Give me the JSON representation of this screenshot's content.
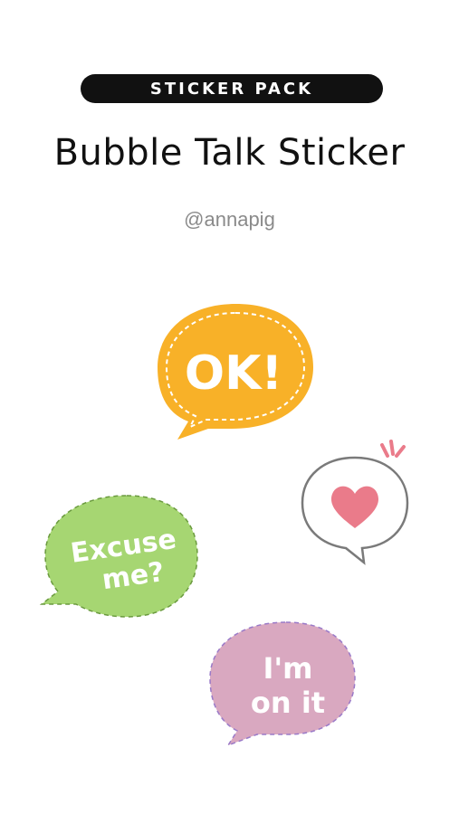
{
  "header": {
    "badge": "STICKER PACK",
    "title": "Bubble Talk Sticker",
    "author": "@annapig"
  },
  "stickers": [
    {
      "id": "ok",
      "text": "OK!",
      "color": "#f8b128"
    },
    {
      "id": "heart",
      "icon": "heart-icon",
      "color": "#ea7b8a"
    },
    {
      "id": "excuse",
      "line1": "Excuse",
      "line2": "me?",
      "color": "#a6d672"
    },
    {
      "id": "onit",
      "line1": "I'm",
      "line2": "on it",
      "color": "#d9a8c0"
    }
  ]
}
